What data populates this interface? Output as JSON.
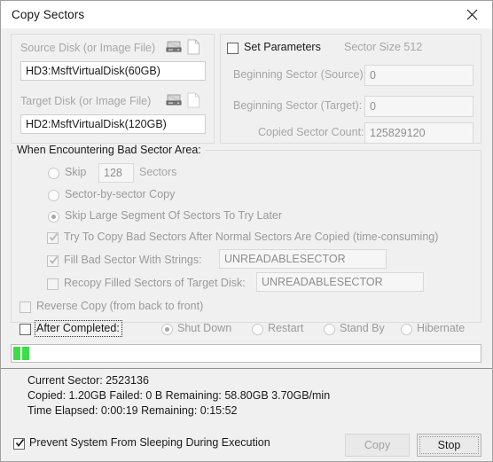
{
  "window": {
    "title": "Copy Sectors",
    "close_icon": "close-icon"
  },
  "source_group": {
    "label": "Source Disk (or Image File)",
    "disk_icon": "hard-disk-icon",
    "file_icon": "file-icon",
    "value": "HD3:MsftVirtualDisk(60GB)"
  },
  "target_group": {
    "label": "Target Disk (or Image File)",
    "disk_icon": "hard-disk-icon",
    "file_icon": "file-icon",
    "value": "HD2:MsftVirtualDisk(120GB)"
  },
  "parameters": {
    "set_parameters_label": "Set Parameters",
    "set_parameters_checked": false,
    "sector_size_label": "Sector Size 512",
    "begin_source_label": "Beginning Sector (Source):",
    "begin_source_value": "0",
    "begin_target_label": "Beginning Sector (Target):",
    "begin_target_value": "0",
    "copied_count_label": "Copied Sector Count:",
    "copied_count_value": "125829120"
  },
  "bad_sector": {
    "legend": "When Encountering Bad Sector Area:",
    "skip_label": "Skip",
    "skip_value": "128",
    "skip_units": "Sectors",
    "sector_by_sector_label": "Sector-by-sector Copy",
    "skip_large_label": "Skip Large Segment Of Sectors To Try Later",
    "selected_option": "skip_large",
    "try_copy_label": "Try To Copy Bad Sectors After Normal Sectors Are Copied (time-consuming)",
    "try_copy_checked": true,
    "fill_label": "Fill Bad Sector With Strings:",
    "fill_checked": true,
    "fill_value": "UNREADABLESECTOR",
    "recopy_label": "Recopy Filled Sectors of Target Disk:",
    "recopy_checked": false,
    "recopy_value": "UNREADABLESECTOR"
  },
  "reverse_copy": {
    "label": "Reverse Copy (from back to front)",
    "checked": false
  },
  "after_completed": {
    "label": "After Completed:",
    "checked": false,
    "options": [
      {
        "label": "Shut Down",
        "selected": true
      },
      {
        "label": "Restart",
        "selected": false
      },
      {
        "label": "Stand By",
        "selected": false
      },
      {
        "label": "Hibernate",
        "selected": false
      }
    ]
  },
  "progress": {
    "percent": 2,
    "chunk_color": "#3ddc4a",
    "chunks": 2
  },
  "status": {
    "line1": "Current Sector: 2523136",
    "line2": "Copied: 1.20GB  Failed: 0 B  Remaining: 58.80GB  3.70GB/min",
    "line3": "Time Elapsed:  0:00:19  Remaining:  0:15:52"
  },
  "footer": {
    "prevent_sleep_label": "Prevent System From Sleeping During Execution",
    "prevent_sleep_checked": true,
    "copy_button": "Copy",
    "stop_button": "Stop"
  }
}
